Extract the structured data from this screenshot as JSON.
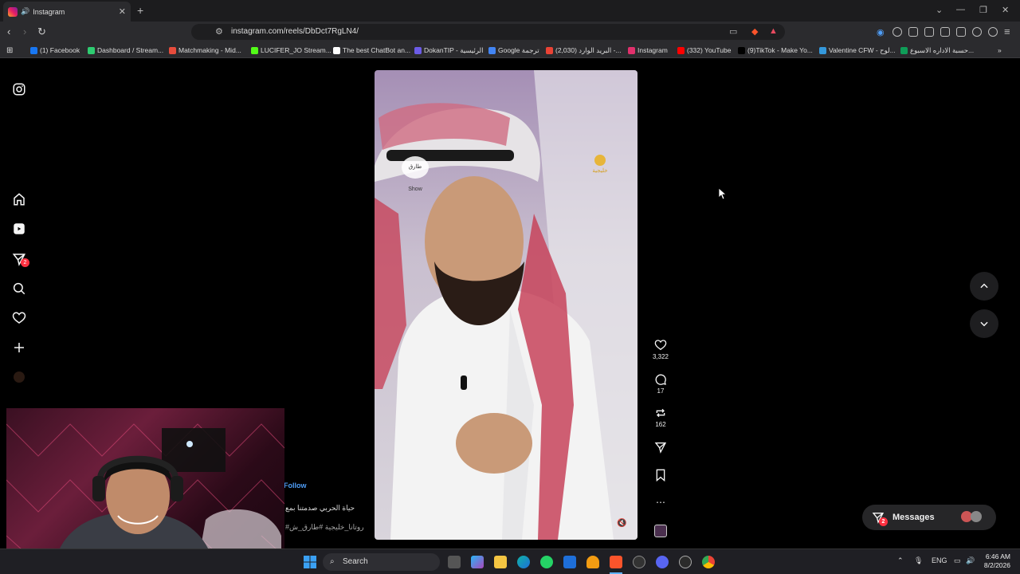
{
  "browser": {
    "tab_title": "Instagram",
    "url": "instagram.com/reels/DbDct7RgLN4/",
    "bookmarks": [
      {
        "label": "(1) Facebook",
        "color": "#1877f2"
      },
      {
        "label": "Dashboard / Stream...",
        "color": "#2ecc71"
      },
      {
        "label": "Matchmaking - Mid...",
        "color": "#e74c3c"
      },
      {
        "label": "LUCIFER_JO Stream...",
        "color": "#53fc18"
      },
      {
        "label": "The best ChatBot an...",
        "color": "#ffffff"
      },
      {
        "label": "DokanTIP - الرئيسية",
        "color": "#6c5ce7"
      },
      {
        "label": "Google ترجمة",
        "color": "#4285f4"
      },
      {
        "label": "(2,030) البريد الوارد -...",
        "color": "#ea4335"
      },
      {
        "label": "Instagram",
        "color": "#e1306c"
      },
      {
        "label": "(332) YouTube",
        "color": "#ff0000"
      },
      {
        "label": "(9)TikTok - Make Yo...",
        "color": "#000000"
      },
      {
        "label": "Valentine CFW - لوح...",
        "color": "#3498db"
      },
      {
        "label": "حسبة الاداره الاسبوع...",
        "color": "#0f9d58"
      }
    ]
  },
  "reel": {
    "likes": "3,322",
    "comments": "17",
    "reposts": "162",
    "follow_label": "Follow",
    "caption_line1": "حياة الحربي صدمتنا بمع",
    "caption_line2": "#روتانا_خليجية #طارق_ش",
    "logo_left": "طارق Show",
    "logo_right": "خليجية"
  },
  "messages": {
    "label": "Messages",
    "badge": "2"
  },
  "sidebar": {
    "dm_badge": "2"
  },
  "taskbar": {
    "search_placeholder": "Search",
    "lang": "ENG",
    "time": "6:46 AM",
    "date": "8/2/2026"
  },
  "colors": {
    "badge": "#ff3040",
    "accent_link": "#4f9ef8"
  }
}
